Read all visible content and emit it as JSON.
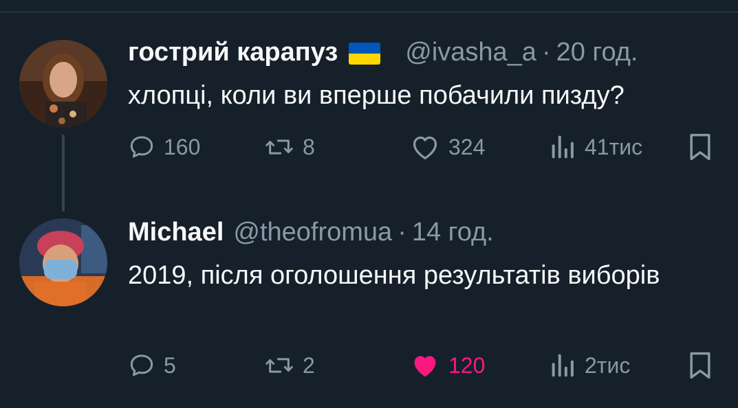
{
  "colors": {
    "background": "#15202b",
    "text_primary": "#f7f9f9",
    "text_secondary": "#8b98a5",
    "divider": "#38444d",
    "like_active": "#f91880"
  },
  "tweets": [
    {
      "author_name": "гострий карапуз",
      "flag_icon": "ukraine-flag-icon",
      "handle": "@ivasha_a",
      "separator": "·",
      "time": "20 год.",
      "text": "хлопці, коли ви вперше побачили пизду?",
      "replies": "160",
      "retweets": "8",
      "likes": "324",
      "liked": false,
      "views": "41тис"
    },
    {
      "author_name": "Michael",
      "handle": "@theofromua",
      "separator": "·",
      "time": "14 год.",
      "text": "2019, після оголошення результатів виборів",
      "replies": "5",
      "retweets": "2",
      "likes": "120",
      "liked": true,
      "views": "2тис"
    }
  ]
}
